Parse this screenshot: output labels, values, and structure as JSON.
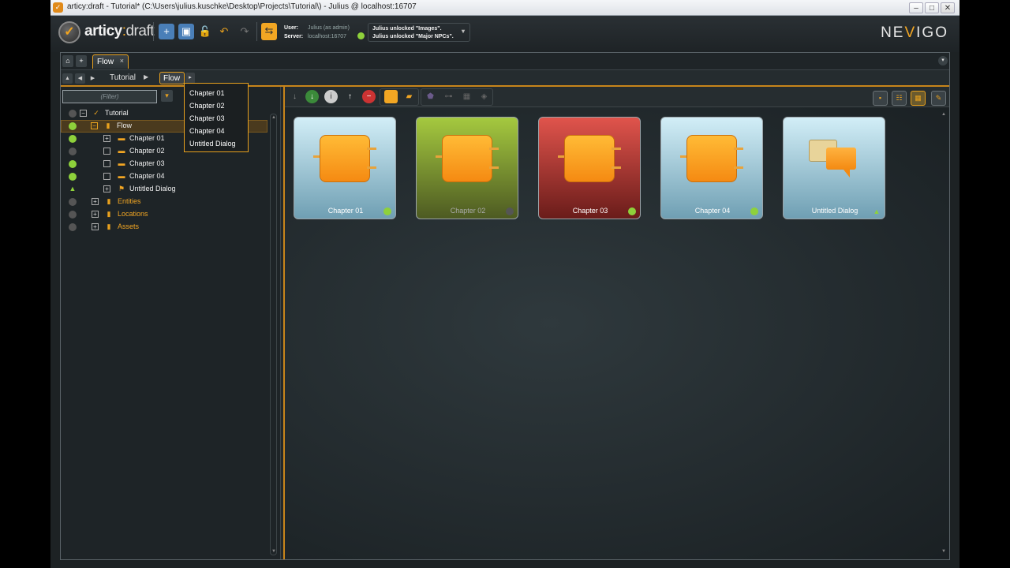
{
  "window": {
    "title": "articy:draft - Tutorial* (C:\\Users\\julius.kuschke\\Desktop\\Projects\\Tutorial\\) - Julius @ localhost:16707",
    "controls": [
      "–",
      "□",
      "✕"
    ]
  },
  "header": {
    "logo_main": "articy",
    "logo_colon": ":",
    "logo_draft": "draft",
    "user_label": "User:",
    "user_value": "Julius (as admin)",
    "server_label": "Server:",
    "server_value": "localhost:16707",
    "notif_1": "Julius unlocked \"Images\".",
    "notif_2": "Julius unlocked \"Major NPCs\".",
    "brand_pre": "NE",
    "brand_v": "V",
    "brand_post": "IGO"
  },
  "tabs": {
    "active_label": "Flow",
    "close": "×"
  },
  "breadcrumb": {
    "items": [
      "Tutorial",
      "Flow"
    ]
  },
  "sidebar": {
    "filter_placeholder": "(Filter)",
    "tree": [
      {
        "label": "Tutorial",
        "level": 0,
        "status": "gray"
      },
      {
        "label": "Flow",
        "level": 1,
        "status": "green",
        "selected": true
      },
      {
        "label": "Chapter 01",
        "level": 2,
        "status": "green"
      },
      {
        "label": "Chapter 02",
        "level": 2,
        "status": "gray"
      },
      {
        "label": "Chapter 03",
        "level": 2,
        "status": "green"
      },
      {
        "label": "Chapter 04",
        "level": 2,
        "status": "green"
      },
      {
        "label": "Untitled Dialog",
        "level": 2,
        "status": "up"
      },
      {
        "label": "Entities",
        "level": 1,
        "status": "gray"
      },
      {
        "label": "Locations",
        "level": 1,
        "status": "gray"
      },
      {
        "label": "Assets",
        "level": 1,
        "status": "gray"
      }
    ]
  },
  "dropdown": {
    "items": [
      "Chapter 01",
      "Chapter 02",
      "Chapter 03",
      "Chapter 04",
      "Untitled Dialog"
    ]
  },
  "cards": [
    {
      "label": "Chapter 01",
      "color": "#9fd1e3",
      "status": "#8ed13b"
    },
    {
      "label": "Chapter 02",
      "color": "#8aa83a",
      "status": "#555"
    },
    {
      "label": "Chapter 03",
      "color": "#c9403a",
      "status": "#8ed13b"
    },
    {
      "label": "Chapter 04",
      "color": "#9fd1e3",
      "status": "#8ed13b"
    },
    {
      "label": "Untitled Dialog",
      "color": "#9fd1e3",
      "status": "up"
    }
  ],
  "colors": {
    "accent": "#e8a11e",
    "status_green": "#8ed13b"
  }
}
